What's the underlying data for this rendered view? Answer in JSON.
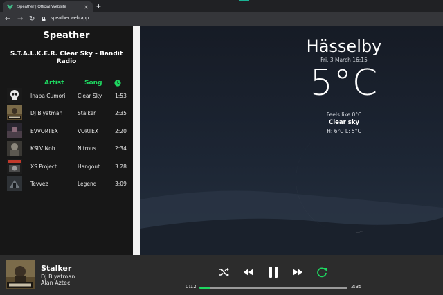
{
  "browser": {
    "tab_title": "Speather | Official Website",
    "url": "speather.web.app"
  },
  "app": {
    "title": "Speather"
  },
  "playlist": {
    "title": "S.T.A.L.K.E.R. Clear Sky - Bandit Radio",
    "columns": {
      "artist": "Artist",
      "song": "Song"
    },
    "tracks": [
      {
        "artist": "Inaba Cumori",
        "song": "Clear Sky",
        "time": "1:53",
        "art": "skull-art"
      },
      {
        "artist": "DJ Blyatman",
        "song": "Stalker",
        "time": "2:35",
        "art": "stalker-art"
      },
      {
        "artist": "EVVORTEX",
        "song": "VORTEX",
        "time": "2:20",
        "art": "vortex-art"
      },
      {
        "artist": "KSLV Noh",
        "song": "Nitrous",
        "time": "2:34",
        "art": "nitrous-art"
      },
      {
        "artist": "XS Project",
        "song": "Hangout",
        "time": "3:28",
        "art": "hangout-art"
      },
      {
        "artist": "Tevvez",
        "song": "Legend",
        "time": "3:09",
        "art": "legend-art"
      }
    ]
  },
  "weather": {
    "city": "Hässelby",
    "date": "Fri, 3 March 16:15",
    "temp": "5°C",
    "feels_like": "Feels like 0°C",
    "condition": "Clear sky",
    "high_low": "H: 6°C L: 5°C",
    "icon": "crescent-moon-icon"
  },
  "player": {
    "song": "Stalker",
    "artist": "DJ Blyatman",
    "album_artist": "Alan Aztec",
    "current_time": "0:12",
    "total_time": "2:35",
    "progress": 0.077,
    "controls": [
      "shuffle-icon",
      "previous-icon",
      "pause-icon",
      "next-icon",
      "repeat-icon"
    ]
  },
  "colors": {
    "accent": "#1ed760",
    "sidebar_bg": "#171717",
    "player_bg": "#2c2c2c",
    "moon": "#d9d9d9"
  }
}
